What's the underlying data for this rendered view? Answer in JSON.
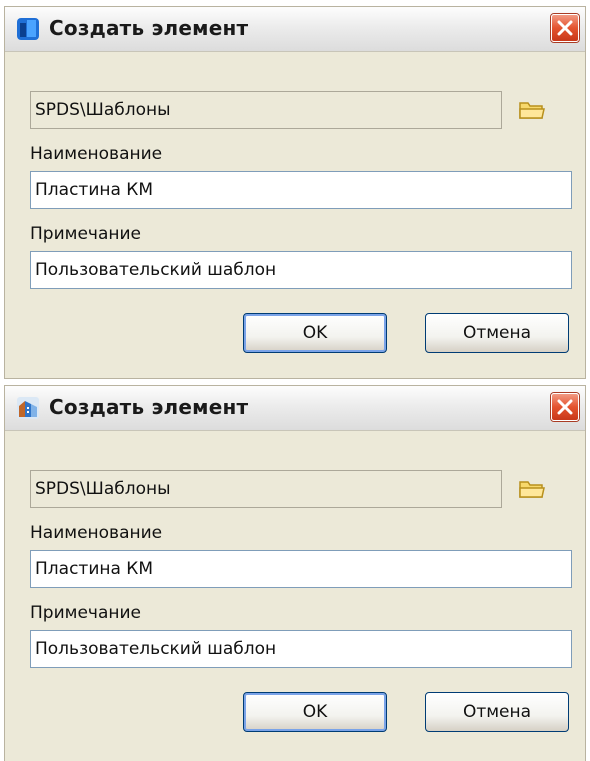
{
  "dialogs": [
    {
      "title": "Создать элемент",
      "icon": "app-icon-blue",
      "path_value": "SPDS\\Шаблоны",
      "name_label": "Наименование",
      "name_value": "Пластина КМ",
      "note_label": "Примечание",
      "note_value": "Пользовательский шаблон",
      "ok_label": "OK",
      "cancel_label": "Отмена"
    },
    {
      "title": "Создать элемент",
      "icon": "app-icon-building",
      "path_value": "SPDS\\Шаблоны",
      "name_label": "Наименование",
      "name_value": "Пластина КМ",
      "note_label": "Примечание",
      "note_value": "Пользовательский шаблон",
      "ok_label": "OK",
      "cancel_label": "Отмена"
    }
  ],
  "colors": {
    "dialog_bg": "#ece9d8",
    "close_red": "#e4532f",
    "button_border": "#003c74",
    "folder_yellow": "#f2c94c"
  }
}
